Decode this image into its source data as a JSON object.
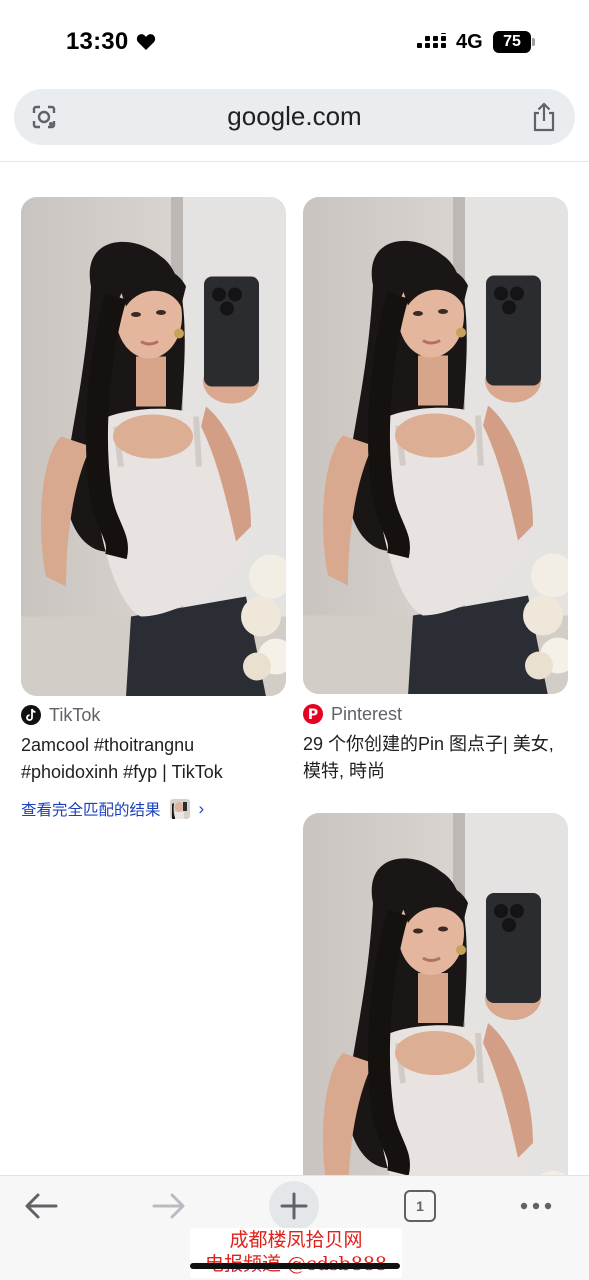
{
  "status_bar": {
    "time": "13:30",
    "network": "4G",
    "battery": "75",
    "icons": [
      "heart-icon",
      "signal-icon",
      "battery-icon"
    ]
  },
  "address_bar": {
    "url": "google.com",
    "icons": [
      "lens-icon",
      "share-icon"
    ]
  },
  "results": [
    {
      "source": "TikTok",
      "title": "2amcool #thoitrangnu #phoidoxinh #fyp | TikTok",
      "image": "selfie-photo"
    },
    {
      "source": "Pinterest",
      "title": "29 个你创建的Pin 图点子| 美女, 模特, 時尚",
      "image": "selfie-photo"
    },
    {
      "source": "",
      "title": "",
      "image": "selfie-photo"
    }
  ],
  "exact_match": {
    "label": "查看完全匹配的结果",
    "chevron": "›"
  },
  "toolbar": {
    "tab_count": "1",
    "icons": [
      "back-arrow-icon",
      "forward-arrow-icon",
      "plus-icon",
      "tabs-icon",
      "more-icon"
    ]
  },
  "watermark": {
    "line1": "成都楼凤拾贝网",
    "line2": "电报频道 @cdsb888"
  },
  "colors": {
    "link_blue": "#1a3fbf",
    "address_bg": "#e9edf0",
    "pinterest_red": "#e60023"
  }
}
